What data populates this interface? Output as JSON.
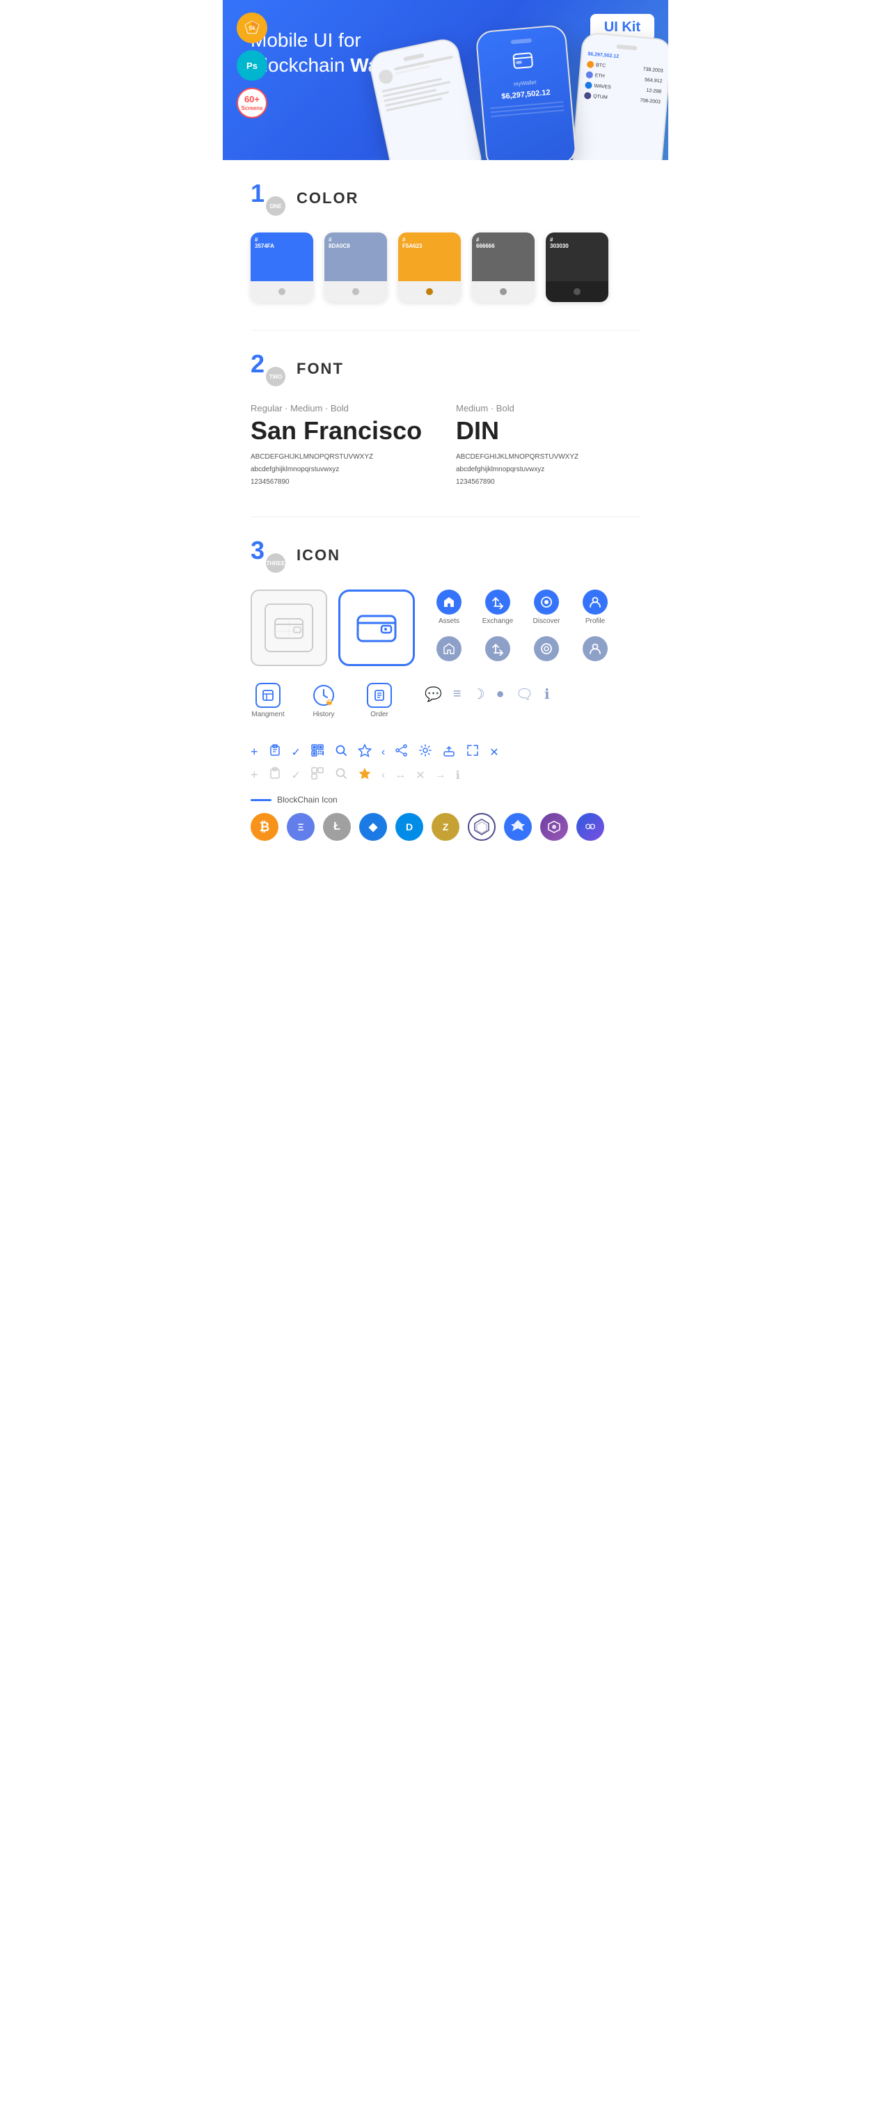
{
  "hero": {
    "title_normal": "Mobile UI for Blockchain ",
    "title_bold": "Wallet",
    "badge": "UI Kit",
    "sketch_label": "Sk",
    "ps_label": "Ps",
    "screens_label": "60+\nScreens"
  },
  "sections": {
    "color": {
      "number": "1",
      "word": "ONE",
      "title": "COLOR",
      "swatches": [
        {
          "hex": "#3574FA",
          "label": "3574FA"
        },
        {
          "hex": "#8DA0C8",
          "label": "8DA0C8"
        },
        {
          "hex": "#F5A623",
          "label": "F5A623"
        },
        {
          "hex": "#666666",
          "label": "666666"
        },
        {
          "hex": "#303030",
          "label": "303030"
        }
      ]
    },
    "font": {
      "number": "2",
      "word": "TWO",
      "title": "FONT",
      "sf": {
        "style": "Regular · Medium · Bold",
        "name": "San Francisco",
        "uppercase": "ABCDEFGHIJKLMNOPQRSTUVWXYZ",
        "lowercase": "abcdefghijklmnopqrstuvwxyz",
        "numbers": "1234567890"
      },
      "din": {
        "style": "Medium · Bold",
        "name": "DIN",
        "uppercase": "ABCDEFGHIJKLMNOPQRSTUVWXYZ",
        "lowercase": "abcdefghijklmnopqrstuvwxyz",
        "numbers": "1234567890"
      }
    },
    "icon": {
      "number": "3",
      "word": "THREE",
      "title": "ICON",
      "named_icons": [
        {
          "label": "Assets"
        },
        {
          "label": "Exchange"
        },
        {
          "label": "Discover"
        },
        {
          "label": "Profile"
        }
      ],
      "bottom_icons": [
        {
          "label": "Mangment"
        },
        {
          "label": "History"
        },
        {
          "label": "Order"
        }
      ],
      "blockchain_label": "BlockChain Icon",
      "crypto": [
        {
          "symbol": "₿",
          "color": "#F7931A",
          "bg": "#fff3e0",
          "label": "BTC"
        },
        {
          "symbol": "Ξ",
          "color": "#627EEA",
          "bg": "#ede7ff",
          "label": "ETH"
        },
        {
          "symbol": "Ł",
          "color": "#A0A0A0",
          "bg": "#f5f5f5",
          "label": "LTC"
        },
        {
          "symbol": "◆",
          "color": "#1B7AE4",
          "bg": "#e3f0ff",
          "label": "WAVES"
        },
        {
          "symbol": "D",
          "color": "#008CE7",
          "bg": "#e0f4ff",
          "label": "DASH"
        },
        {
          "symbol": "Z",
          "color": "#b5a0d8",
          "bg": "#f0ecff",
          "label": "ZEC"
        },
        {
          "symbol": "◎",
          "color": "#4a4a8a",
          "bg": "#ebebf5",
          "label": "NET"
        },
        {
          "symbol": "▲",
          "color": "#3574FA",
          "bg": "#e8efff",
          "label": "ARK"
        },
        {
          "symbol": "◈",
          "color": "#9b59b6",
          "bg": "#f5eaff",
          "label": "QTUM"
        },
        {
          "symbol": "∞",
          "color": "#E91E63",
          "bg": "#fce4ec",
          "label": "MAT"
        }
      ]
    }
  }
}
